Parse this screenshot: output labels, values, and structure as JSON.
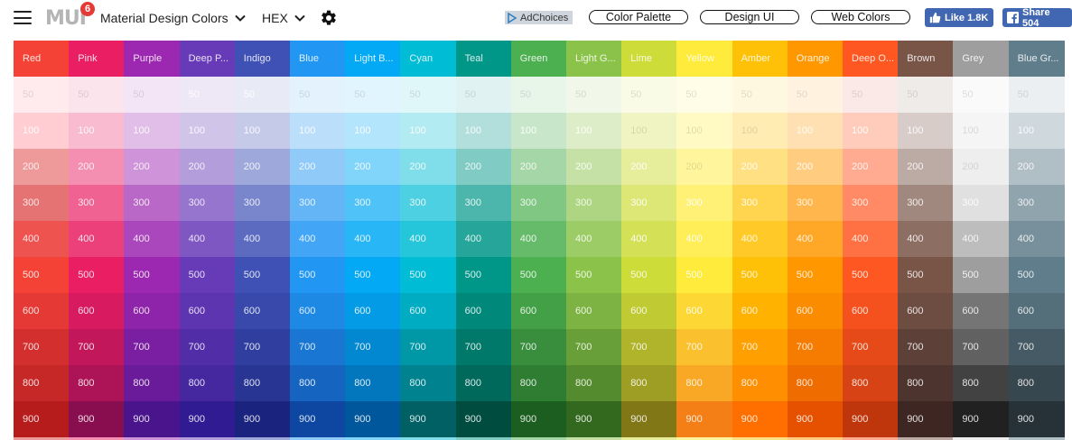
{
  "header": {
    "menu_icon": "hamburger-menu-icon",
    "logo_text": "MUI",
    "logo_badge": "6",
    "site_dropdown": "Material Design Colors",
    "format_dropdown": "HEX",
    "settings_icon": "gear-icon",
    "adchoices": "AdChoices",
    "nav": [
      "Color Palette",
      "Design UI",
      "Web Colors"
    ],
    "fb_like": "Like 1.8K",
    "fb_share": "Share 504"
  },
  "shades": [
    "50",
    "100",
    "200",
    "300",
    "400",
    "500",
    "600",
    "700",
    "800",
    "900"
  ],
  "palette": [
    {
      "name": "Red",
      "colors": [
        "#FFEBEE",
        "#FFCDD2",
        "#EF9A9A",
        "#E57373",
        "#EF5350",
        "#F44336",
        "#E53935",
        "#D32F2F",
        "#C62828",
        "#B71C1C"
      ]
    },
    {
      "name": "Pink",
      "colors": [
        "#FCE4EC",
        "#F8BBD0",
        "#F48FB1",
        "#F06292",
        "#EC407A",
        "#E91E63",
        "#D81B60",
        "#C2185B",
        "#AD1457",
        "#880E4F"
      ]
    },
    {
      "name": "Purple",
      "colors": [
        "#F3E5F5",
        "#E1BEE7",
        "#CE93D8",
        "#BA68C8",
        "#AB47BC",
        "#9C27B0",
        "#8E24AA",
        "#7B1FA2",
        "#6A1B9A",
        "#4A148C"
      ]
    },
    {
      "name": "Deep P...",
      "colors": [
        "#EDE7F6",
        "#D1C4E9",
        "#B39DDB",
        "#9575CD",
        "#7E57C2",
        "#673AB7",
        "#5E35B1",
        "#512DA8",
        "#4527A0",
        "#311B92"
      ]
    },
    {
      "name": "Indigo",
      "colors": [
        "#E8EAF6",
        "#C5CAE9",
        "#9FA8DA",
        "#7986CB",
        "#5C6BC0",
        "#3F51B5",
        "#3949AB",
        "#303F9F",
        "#283593",
        "#1A237E"
      ]
    },
    {
      "name": "Blue",
      "colors": [
        "#E3F2FD",
        "#BBDEFB",
        "#90CAF9",
        "#64B5F6",
        "#42A5F5",
        "#2196F3",
        "#1E88E5",
        "#1976D2",
        "#1565C0",
        "#0D47A1"
      ]
    },
    {
      "name": "Light B...",
      "colors": [
        "#E1F5FE",
        "#B3E5FC",
        "#81D4FA",
        "#4FC3F7",
        "#29B6F6",
        "#03A9F4",
        "#039BE5",
        "#0288D1",
        "#0277BD",
        "#01579B"
      ]
    },
    {
      "name": "Cyan",
      "colors": [
        "#E0F7FA",
        "#B2EBF2",
        "#80DEEA",
        "#4DD0E1",
        "#26C6DA",
        "#00BCD4",
        "#00ACC1",
        "#0097A7",
        "#00838F",
        "#006064"
      ]
    },
    {
      "name": "Teal",
      "colors": [
        "#E0F2F1",
        "#B2DFDB",
        "#80CBC4",
        "#4DB6AC",
        "#26A69A",
        "#009688",
        "#00897B",
        "#00796B",
        "#00695C",
        "#004D40"
      ]
    },
    {
      "name": "Green",
      "colors": [
        "#E8F5E9",
        "#C8E6C9",
        "#A5D6A7",
        "#81C784",
        "#66BB6A",
        "#4CAF50",
        "#43A047",
        "#388E3C",
        "#2E7D32",
        "#1B5E20"
      ]
    },
    {
      "name": "Light G...",
      "colors": [
        "#F1F8E9",
        "#DCEDC8",
        "#C5E1A5",
        "#AED581",
        "#9CCC65",
        "#8BC34A",
        "#7CB342",
        "#689F38",
        "#558B2F",
        "#33691E"
      ]
    },
    {
      "name": "Lime",
      "colors": [
        "#F9FBE7",
        "#F0F4C3",
        "#E6EE9C",
        "#DCE775",
        "#D4E157",
        "#CDDC39",
        "#C0CA33",
        "#AFB42B",
        "#9E9D24",
        "#827717"
      ]
    },
    {
      "name": "Yellow",
      "colors": [
        "#FFFDE7",
        "#FFF9C4",
        "#FFF59D",
        "#FFF176",
        "#FFEE58",
        "#FFEB3B",
        "#FDD835",
        "#FBC02D",
        "#F9A825",
        "#F57F17"
      ]
    },
    {
      "name": "Amber",
      "colors": [
        "#FFF8E1",
        "#FFECB3",
        "#FFE082",
        "#FFD54F",
        "#FFCA28",
        "#FFC107",
        "#FFB300",
        "#FFA000",
        "#FF8F00",
        "#FF6F00"
      ]
    },
    {
      "name": "Orange",
      "colors": [
        "#FFF3E0",
        "#FFE0B2",
        "#FFCC80",
        "#FFB74D",
        "#FFA726",
        "#FF9800",
        "#FB8C00",
        "#F57C00",
        "#EF6C00",
        "#E65100"
      ]
    },
    {
      "name": "Deep O...",
      "colors": [
        "#FBE9E7",
        "#FFCCBC",
        "#FFAB91",
        "#FF8A65",
        "#FF7043",
        "#FF5722",
        "#F4511E",
        "#E64A19",
        "#D84315",
        "#BF360C"
      ]
    },
    {
      "name": "Brown",
      "colors": [
        "#EFEBE9",
        "#D7CCC8",
        "#BCAAA4",
        "#A1887F",
        "#8D6E63",
        "#795548",
        "#6D4C41",
        "#5D4037",
        "#4E342E",
        "#3E2723"
      ]
    },
    {
      "name": "Grey",
      "colors": [
        "#FAFAFA",
        "#F5F5F5",
        "#EEEEEE",
        "#E0E0E0",
        "#BDBDBD",
        "#9E9E9E",
        "#757575",
        "#616161",
        "#424242",
        "#212121"
      ]
    },
    {
      "name": "Blue Gr...",
      "colors": [
        "#ECEFF1",
        "#CFD8DC",
        "#B0BEC5",
        "#90A4AE",
        "#78909C",
        "#607D8B",
        "#546E7A",
        "#455A64",
        "#37474F",
        "#263238"
      ]
    }
  ]
}
